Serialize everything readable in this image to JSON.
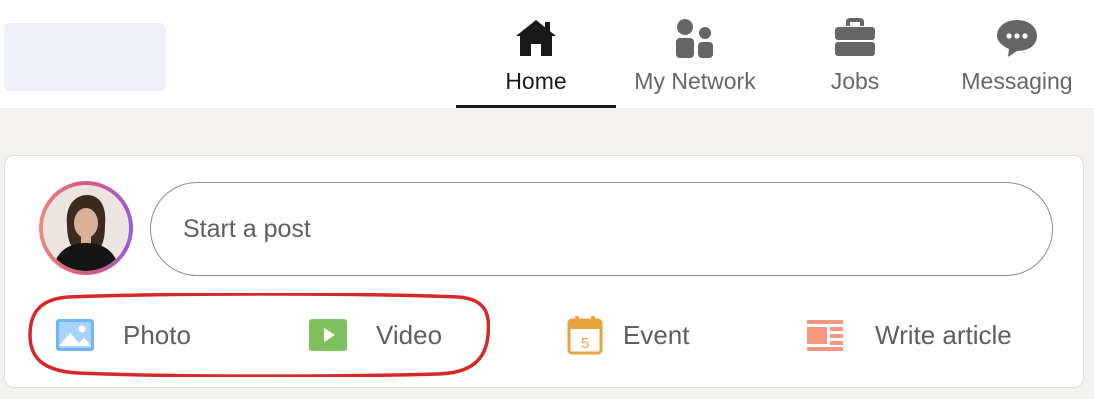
{
  "nav": {
    "items": [
      {
        "label": "Home",
        "icon": "home-icon",
        "active": true
      },
      {
        "label": "My Network",
        "icon": "network-icon",
        "active": false
      },
      {
        "label": "Jobs",
        "icon": "briefcase-icon",
        "active": false
      },
      {
        "label": "Messaging",
        "icon": "messaging-icon",
        "active": false
      }
    ]
  },
  "composer": {
    "placeholder": "Start a post",
    "actions": [
      {
        "label": "Photo",
        "icon": "photo-icon",
        "color": "#70b5f9"
      },
      {
        "label": "Video",
        "icon": "video-icon",
        "color": "#7fc15e"
      },
      {
        "label": "Event",
        "icon": "calendar-icon",
        "color": "#e7a33e",
        "day": "5"
      },
      {
        "label": "Write article",
        "icon": "article-icon",
        "color": "#f5987e"
      }
    ]
  },
  "annotation": {
    "color": "#d62828"
  }
}
